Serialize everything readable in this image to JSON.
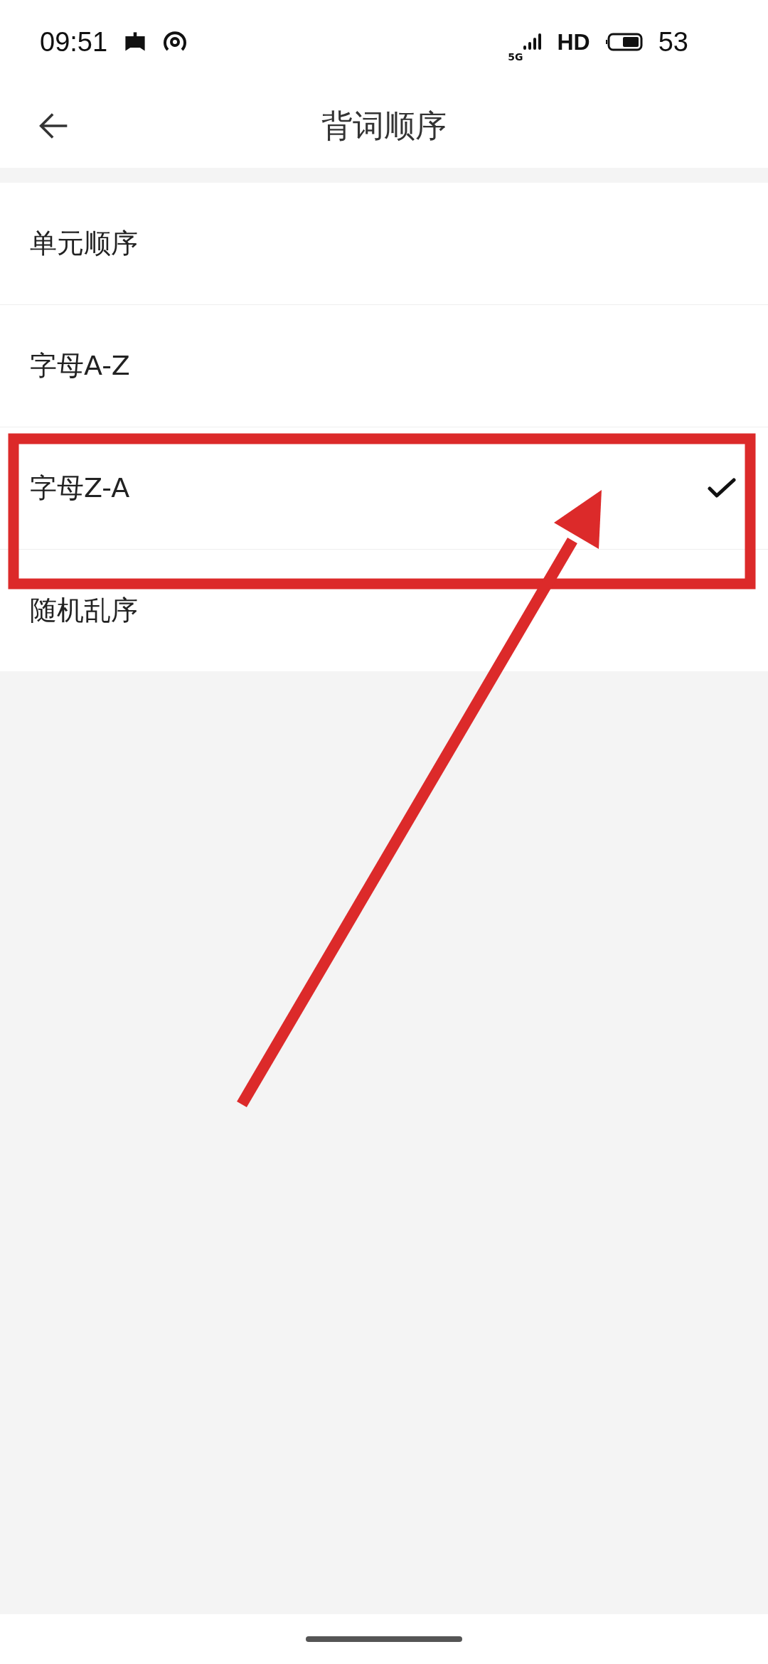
{
  "status_bar": {
    "time": "09:51",
    "network": "5G",
    "hd": "HD",
    "battery": "53"
  },
  "header": {
    "title": "背词顺序"
  },
  "options": [
    {
      "label": "单元顺序",
      "selected": false
    },
    {
      "label": "字母A-Z",
      "selected": false
    },
    {
      "label": "字母Z-A",
      "selected": true
    },
    {
      "label": "随机乱序",
      "selected": false
    }
  ],
  "annotations": {
    "frame": true,
    "arrow": true
  }
}
